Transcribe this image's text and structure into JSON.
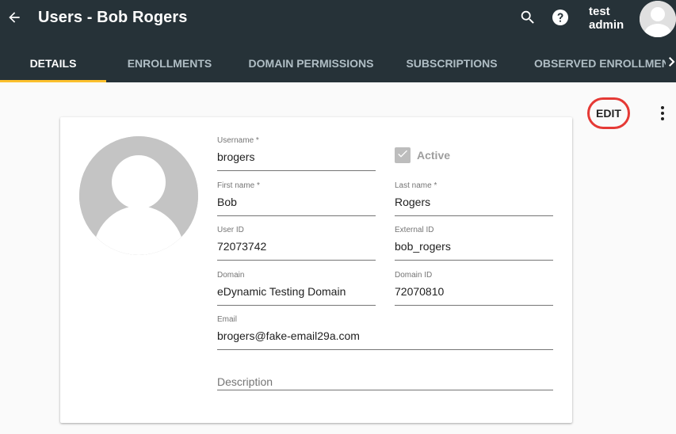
{
  "header": {
    "title": "Users - Bob Rogers",
    "user_line1": "test",
    "user_line2": "admin",
    "icons": [
      "arrow-back-icon",
      "search-icon",
      "help-icon",
      "account-icon"
    ],
    "background": "#263238"
  },
  "tabs": [
    {
      "label": "DETAILS",
      "active": true
    },
    {
      "label": "ENROLLMENTS",
      "active": false
    },
    {
      "label": "DOMAIN PERMISSIONS",
      "active": false
    },
    {
      "label": "SUBSCRIPTIONS",
      "active": false
    },
    {
      "label": "OBSERVED ENROLLMENTS",
      "active": false
    }
  ],
  "tab_indicator_color": "#fbc02d",
  "actions": {
    "edit_label": "EDIT",
    "highlight_color": "#e53935"
  },
  "form": {
    "username": {
      "label": "Username *",
      "value": "brogers"
    },
    "active": {
      "label": "Active",
      "checked": true
    },
    "first_name": {
      "label": "First name *",
      "value": "Bob"
    },
    "last_name": {
      "label": "Last name *",
      "value": "Rogers"
    },
    "user_id": {
      "label": "User ID",
      "value": "72073742"
    },
    "external_id": {
      "label": "External ID",
      "value": "bob_rogers"
    },
    "domain": {
      "label": "Domain",
      "value": "eDynamic Testing Domain"
    },
    "domain_id": {
      "label": "Domain ID",
      "value": "72070810"
    },
    "email": {
      "label": "Email",
      "value": "brogers@fake-email29a.com"
    },
    "description": {
      "placeholder": "Description"
    }
  }
}
